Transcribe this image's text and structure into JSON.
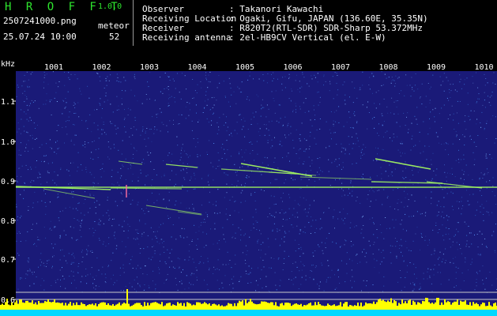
{
  "app": {
    "name": "H R O F F T",
    "version": "1.0.0"
  },
  "left": {
    "filename": "2507241000.png",
    "datetime": "25.07.24 10:00",
    "meteor_label": "meteor",
    "meteor_count": "52"
  },
  "info": {
    "observer_label": "Observer",
    "observer_value": ": Takanori Kawachi",
    "location_label": "Receiving Location",
    "location_value": ": Ogaki, Gifu, JAPAN (136.60E, 35.35N)",
    "receiver_label": "Receiver",
    "receiver_value": ": R820T2(RTL-SDR) SDR-Sharp 53.372MHz",
    "antenna_label": "Receiving antenna",
    "antenna_value": ": 2el-HB9CV Vertical (el. E-W)"
  },
  "axis": {
    "unit": "kHz",
    "y_ticks": [
      "1.1",
      "1.0",
      "0.9",
      "0.8",
      "0.7",
      "0.6"
    ],
    "x_ticks": [
      "1001",
      "1002",
      "1003",
      "1004",
      "1005",
      "1006",
      "1007",
      "1008",
      "1009",
      "1010"
    ]
  },
  "colors": {
    "background": "#1a1a78",
    "noise": "#3a7ee0",
    "echo": "#a8ff60",
    "baseline_fill": "#ffff00",
    "baseline_band": "#00d8ff"
  }
}
